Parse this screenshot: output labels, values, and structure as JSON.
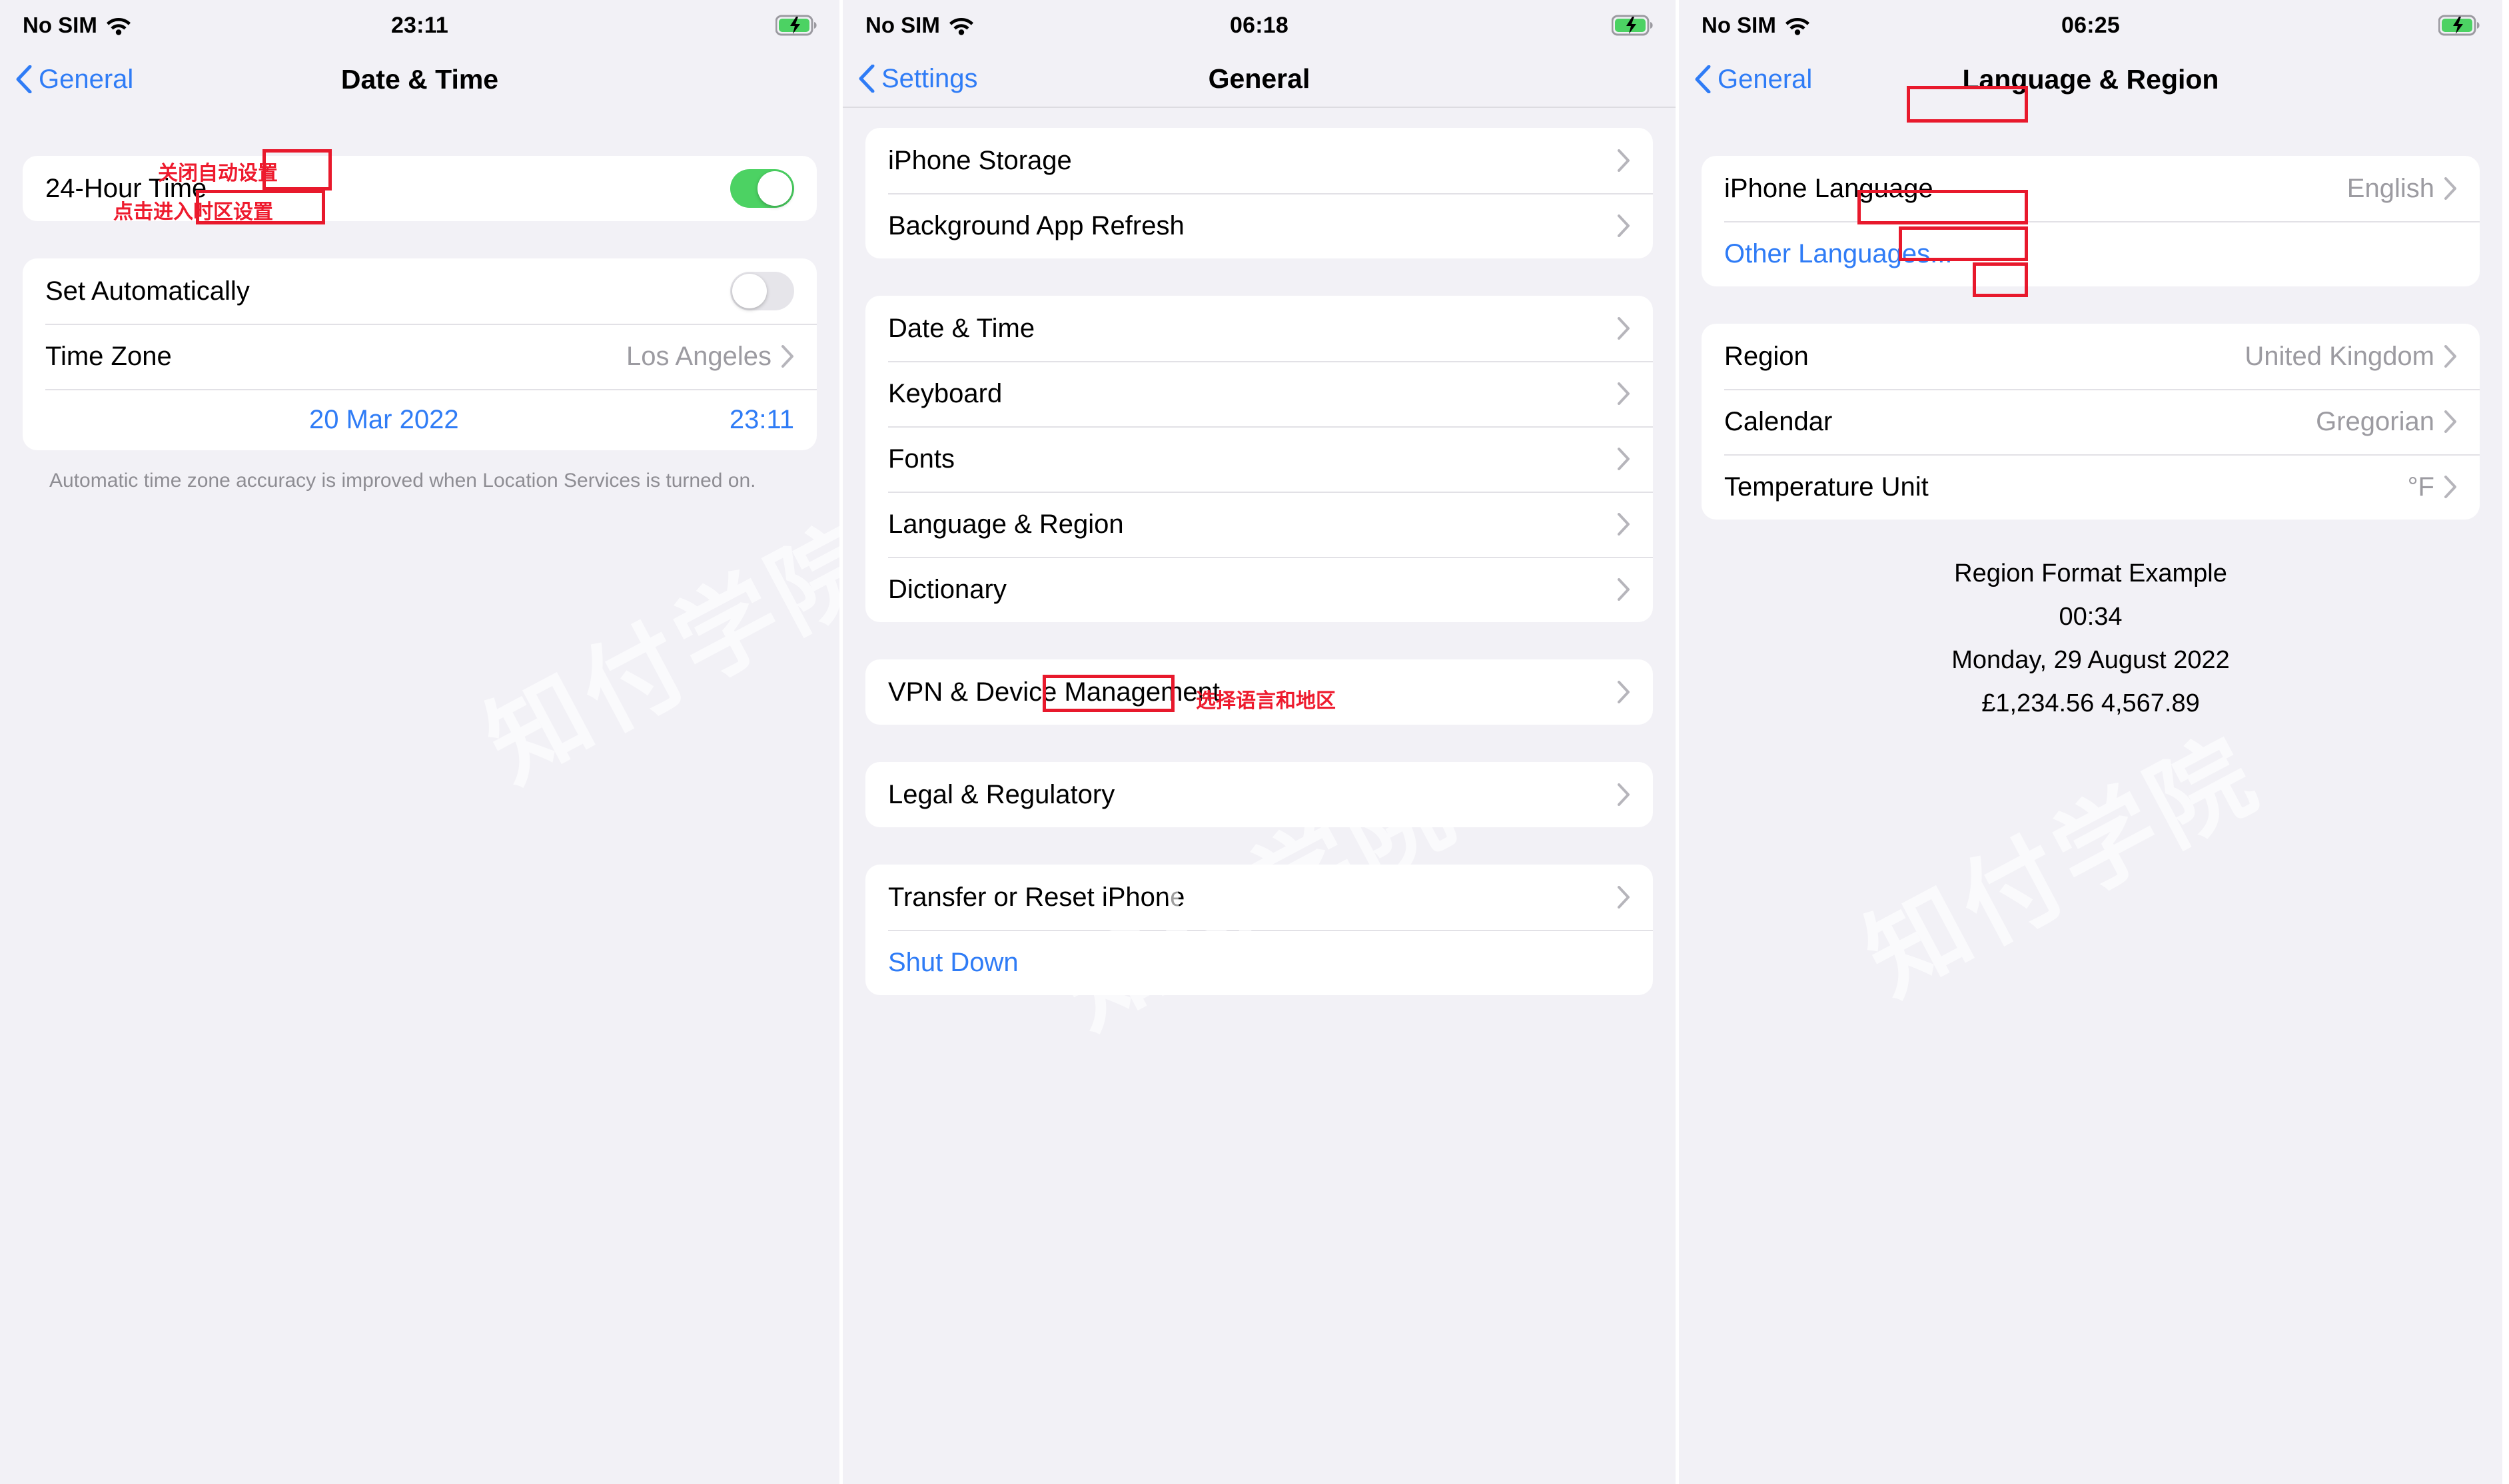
{
  "panels": [
    {
      "status": {
        "carrier": "No SIM",
        "time": "23:11",
        "wifi_icon": "wifi-icon",
        "battery_icon": "battery-charging-icon"
      },
      "nav": {
        "back_label": "General",
        "title": "Date & Time",
        "back_icon": "chevron-left-icon"
      },
      "group1": [
        {
          "label": "24-Hour Time",
          "control": "toggle",
          "state": "on"
        }
      ],
      "group2": [
        {
          "label": "Set Automatically",
          "control": "toggle",
          "state": "off"
        },
        {
          "label": "Time Zone",
          "value": "Los Angeles",
          "control": "disclosure"
        }
      ],
      "picker": {
        "date": "20 Mar 2022",
        "time": "23:11"
      },
      "footnote": "Automatic time zone accuracy is improved when Location Services is turned on.",
      "annotations": [
        {
          "text": "关闭自动设置"
        },
        {
          "text": "点击进入时区设置"
        }
      ]
    },
    {
      "status": {
        "carrier": "No SIM",
        "time": "06:18",
        "wifi_icon": "wifi-icon",
        "battery_icon": "battery-charging-icon"
      },
      "nav": {
        "back_label": "Settings",
        "title": "General",
        "back_icon": "chevron-left-icon"
      },
      "groups": [
        [
          {
            "label": "iPhone Storage"
          },
          {
            "label": "Background App Refresh"
          }
        ],
        [
          {
            "label": "Date & Time"
          },
          {
            "label": "Keyboard"
          },
          {
            "label": "Fonts"
          },
          {
            "label": "Language & Region",
            "highlighted": true
          },
          {
            "label": "Dictionary"
          }
        ],
        [
          {
            "label": "VPN & Device Management"
          }
        ],
        [
          {
            "label": "Legal & Regulatory"
          }
        ],
        [
          {
            "label": "Transfer or Reset iPhone"
          },
          {
            "label": "Shut Down",
            "blue": true,
            "no_chevron": true
          }
        ]
      ],
      "annotations": [
        {
          "text": "选择语言和地区"
        }
      ]
    },
    {
      "status": {
        "carrier": "No SIM",
        "time": "06:25",
        "wifi_icon": "wifi-icon",
        "battery_icon": "battery-charging-icon"
      },
      "nav": {
        "back_label": "General",
        "title": "Language & Region",
        "back_icon": "chevron-left-icon"
      },
      "group1": [
        {
          "label": "iPhone Language",
          "value": "English",
          "control": "disclosure",
          "boxed": true
        },
        {
          "label": "Other Languages...",
          "blue": true,
          "no_chevron": true
        }
      ],
      "group2": [
        {
          "label": "Region",
          "value": "United Kingdom",
          "control": "disclosure",
          "boxed": true
        },
        {
          "label": "Calendar",
          "value": "Gregorian",
          "control": "disclosure",
          "boxed": true
        },
        {
          "label": "Temperature Unit",
          "value": "°F",
          "control": "disclosure",
          "boxed": true
        }
      ],
      "region_format": {
        "title": "Region Format Example",
        "time": "00:34",
        "date": "Monday, 29 August 2022",
        "numbers": "£1,234.56   4,567.89"
      }
    }
  ],
  "colors": {
    "accent_blue": "#2f7cf6",
    "toggle_on_green": "#4cd263",
    "annotation_red": "#e8192c",
    "page_background": "#f2f1f6",
    "card_background": "#ffffff",
    "secondary_text": "#9c9ba1"
  },
  "watermark": "知付学院"
}
